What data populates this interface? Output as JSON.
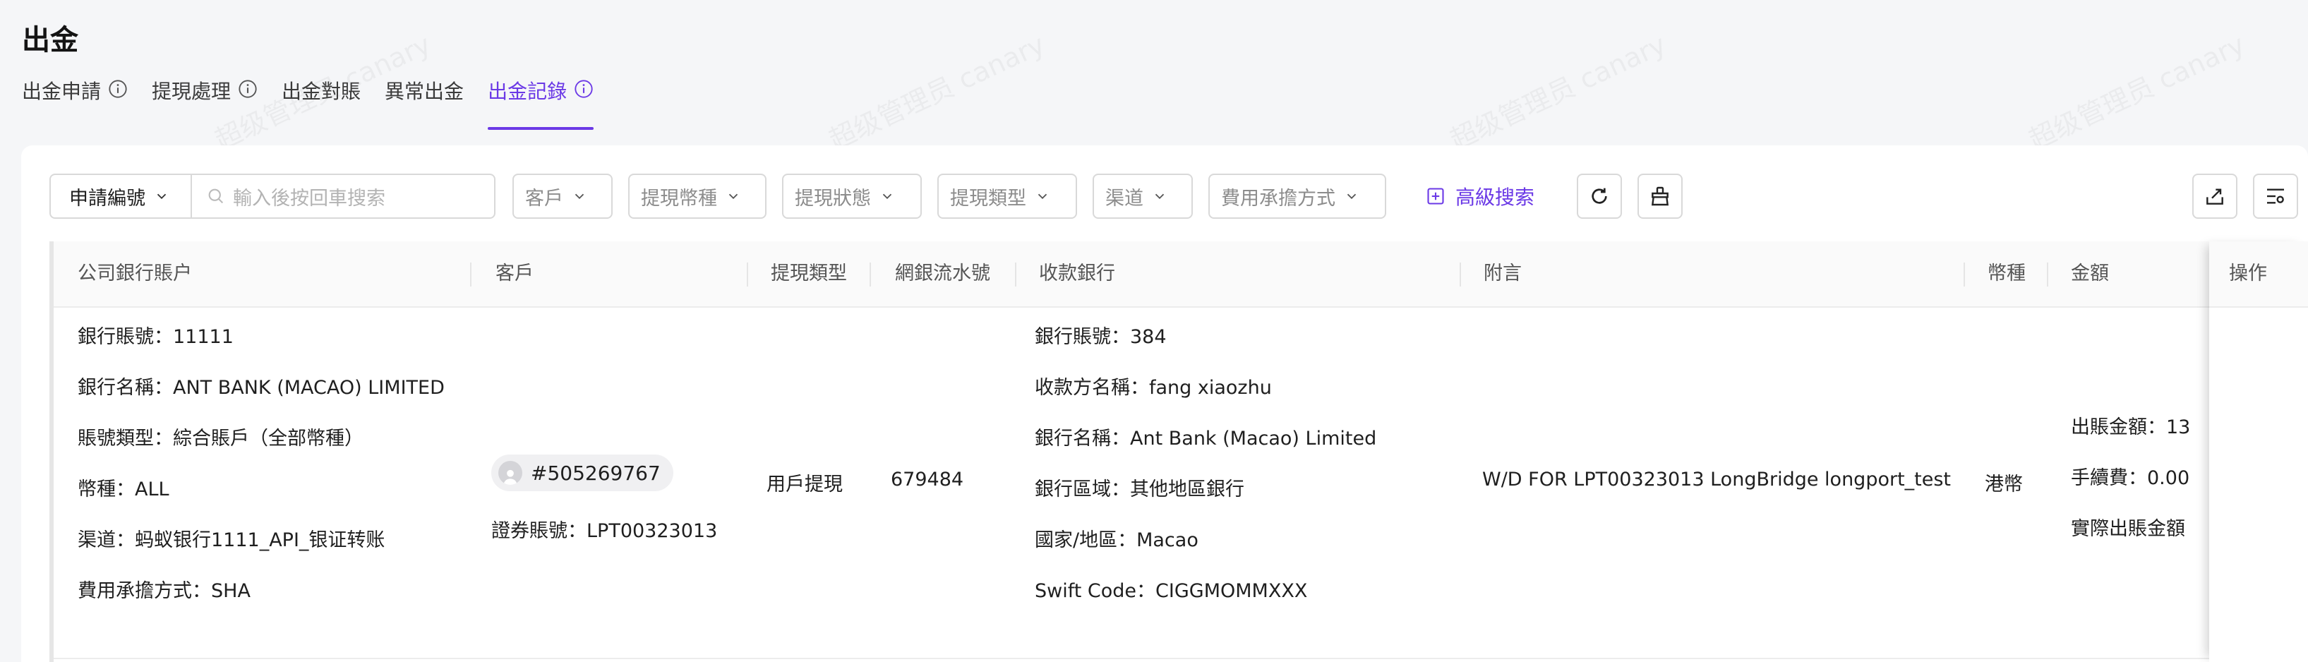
{
  "page": {
    "title": "出金"
  },
  "tabs": [
    {
      "label": "出金申請",
      "has_info": true,
      "active": false
    },
    {
      "label": "提現處理",
      "has_info": true,
      "active": false
    },
    {
      "label": "出金對賬",
      "has_info": false,
      "active": false
    },
    {
      "label": "異常出金",
      "has_info": false,
      "active": false
    },
    {
      "label": "出金記錄",
      "has_info": true,
      "active": true
    }
  ],
  "filters": {
    "search_field": "申請編號",
    "search_placeholder": "輸入後按回車搜索",
    "customer": "客戶",
    "currency": "提現幣種",
    "status": "提現狀態",
    "type": "提現類型",
    "channel": "渠道",
    "fee": "費用承擔方式",
    "advanced_search": "高級搜索"
  },
  "table": {
    "headers": {
      "company_account": "公司銀行賬户",
      "customer": "客戶",
      "withdraw_type": "提現類型",
      "bank_serial": "網銀流水號",
      "receiving_bank": "收款銀行",
      "remark": "附言",
      "currency": "幣種",
      "amount": "金額",
      "actions": "操作"
    },
    "rows": [
      {
        "company_account": {
          "bank_account_no": "銀行賬號：11111",
          "bank_name": "銀行名稱：ANT BANK (MACAO) LIMITED",
          "account_type": "賬號類型：綜合賬戶（全部幣種）",
          "currency": "幣種：ALL",
          "channel": "渠道：蚂蚁银行1111_API_银证转账",
          "fee_method": "費用承擔方式：SHA"
        },
        "customer": {
          "id": "#505269767",
          "securities_account": "證券賬號：LPT00323013"
        },
        "withdraw_type": "用戶提現",
        "bank_serial": "679484",
        "receiving_bank": {
          "bank_account_no": "銀行賬號：384",
          "payee_name": "收款方名稱：fang xiaozhu",
          "bank_name": "銀行名稱：Ant Bank (Macao) Limited",
          "bank_region": "銀行區域：其他地區銀行",
          "country": "國家/地區：Macao",
          "swift": "Swift Code：CIGGMOMMXXX"
        },
        "remark": "W/D FOR LPT00323013 LongBridge longport_test",
        "currency": "港幣",
        "amount": {
          "out_amount": "出賬金額：13",
          "fee": "手續費：0.00",
          "actual_out": "實際出賬金額"
        }
      }
    ]
  },
  "watermark": "超级管理员 canary",
  "colors": {
    "accent": "#6b39e6"
  }
}
